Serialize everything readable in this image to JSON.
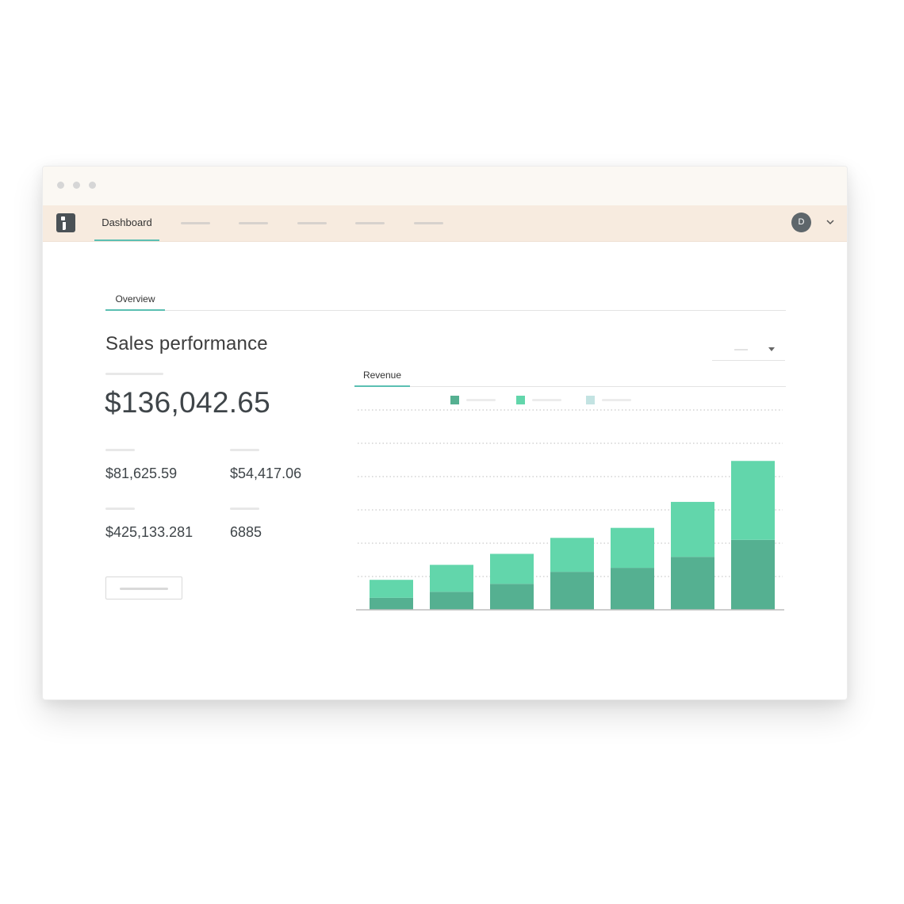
{
  "nav": {
    "active_tab": "Dashboard",
    "avatar_initial": "D"
  },
  "tabs": {
    "overview": "Overview"
  },
  "sales": {
    "title": "Sales performance",
    "total": "$136,042.65",
    "stats": [
      "$81,625.59",
      "$54,417.06",
      "$425,133.281",
      "6885"
    ]
  },
  "revenue_tab": "Revenue",
  "colors": {
    "accent": "#5bbfb2",
    "series_dark": "#55b091",
    "series_light": "#62d6ab",
    "legend_third": "#c3e3e2"
  },
  "chart_data": {
    "type": "bar",
    "stacked": true,
    "categories": [
      "",
      "",
      "",
      "",
      "",
      "",
      ""
    ],
    "series": [
      {
        "values": [
          12,
          18,
          26,
          38,
          42,
          53,
          70
        ]
      },
      {
        "values": [
          18,
          27,
          30,
          34,
          40,
          55,
          79
        ]
      }
    ],
    "ylim": [
      0,
      200
    ],
    "grid": true,
    "legend": "top"
  }
}
